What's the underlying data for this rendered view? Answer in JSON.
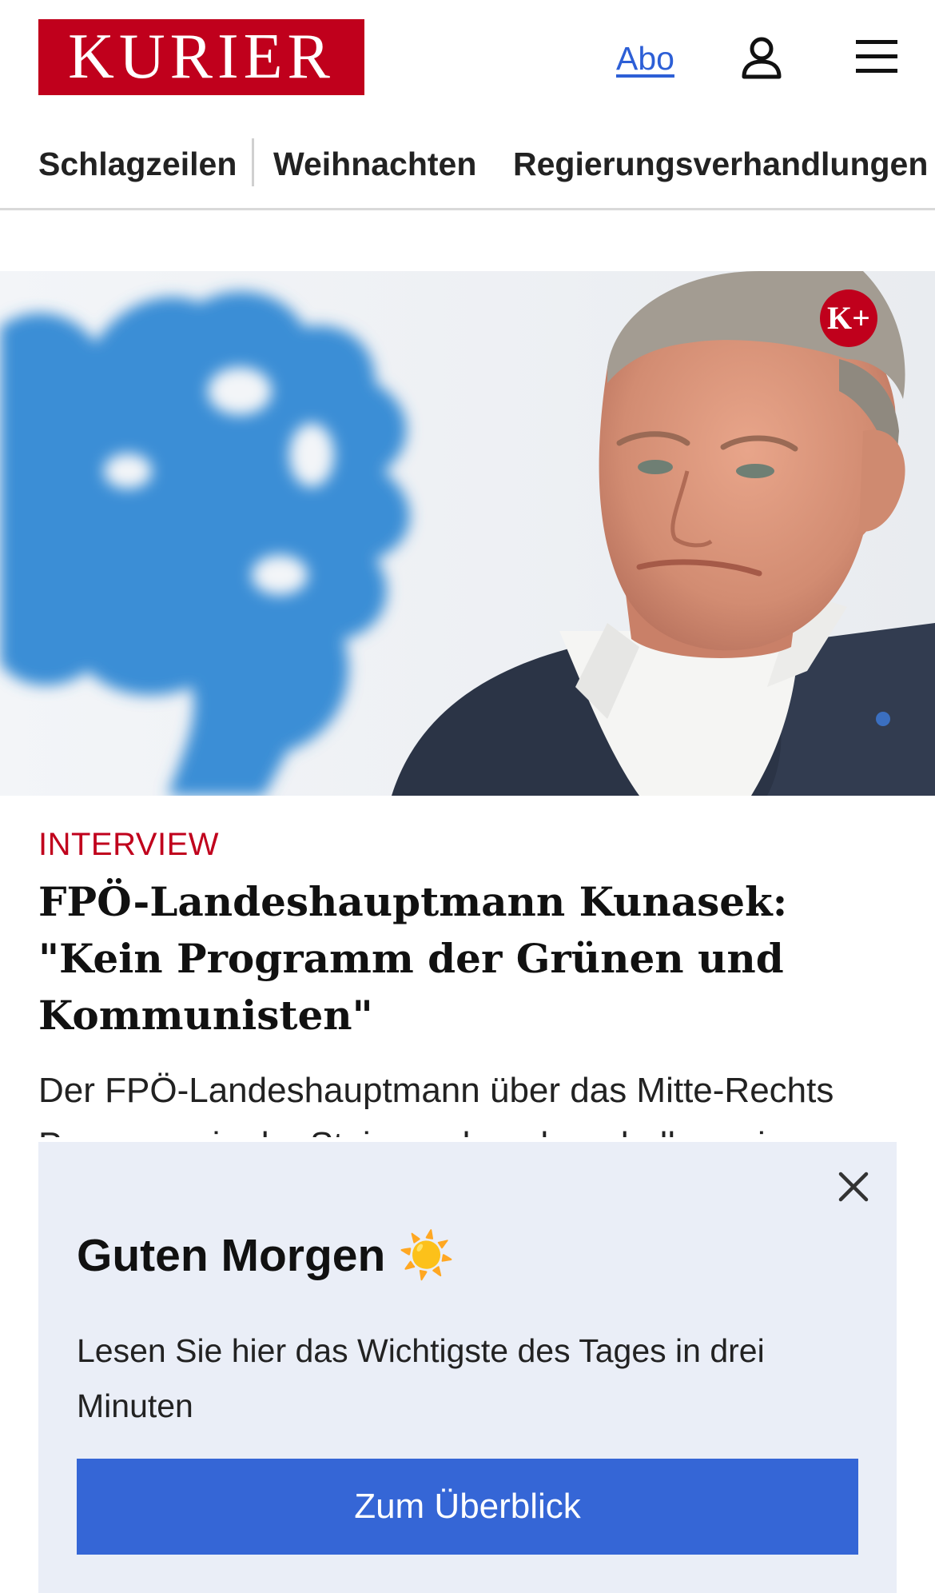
{
  "header": {
    "logo_text": "KURIER",
    "abo_label": "Abo",
    "user_icon": "user-icon",
    "menu_icon": "hamburger-menu-icon"
  },
  "nav": {
    "items": [
      {
        "label": "Schlagzeilen"
      },
      {
        "label": "Weihnachten"
      },
      {
        "label": "Regierungsverhandlungen"
      }
    ]
  },
  "article": {
    "badge": "K+",
    "kicker": "INTERVIEW",
    "headline": "FPÖ-Landeshauptmann Kunasek: \"Kein Programm der Grünen und Kommunisten\"",
    "teaser": "Der FPÖ-Landeshauptmann über das Mitte-Rechts Programm in der Steiermark und weshalb er ein"
  },
  "popup": {
    "title": "Guten Morgen ☀️",
    "text": "Lesen Sie hier das Wichtigste des Tages in drei Minuten",
    "button_label": "Zum Überblick",
    "close_icon": "close-icon"
  },
  "colors": {
    "brand_red": "#c0001c",
    "link_blue": "#2d5fd6",
    "button_blue": "#3566d6",
    "popup_bg": "#eaeef7"
  }
}
